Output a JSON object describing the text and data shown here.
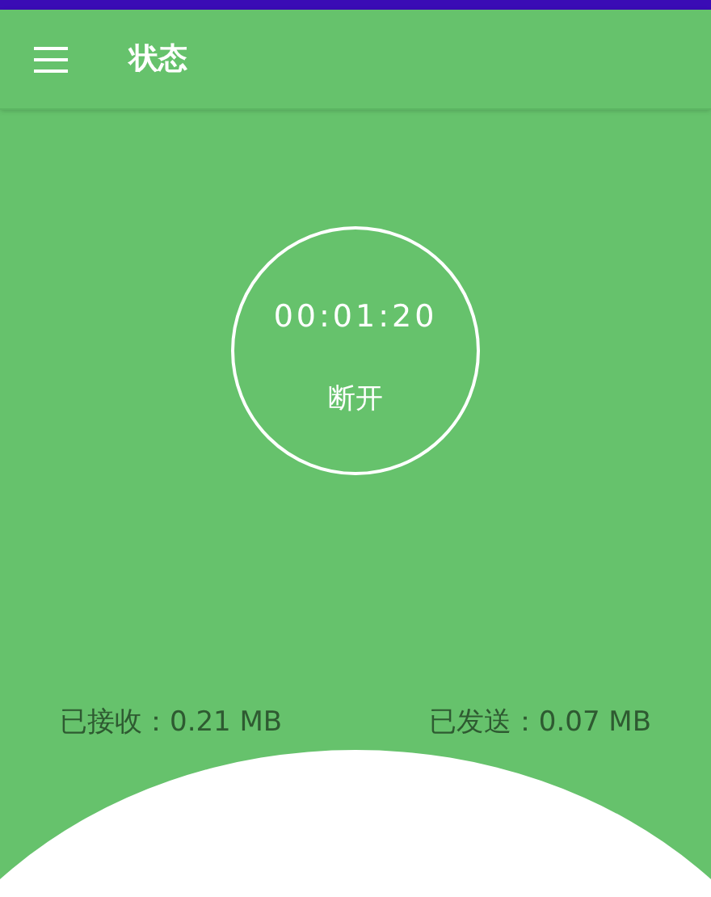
{
  "app_bar": {
    "title": "状态"
  },
  "session": {
    "timer": "00:01:20",
    "action": "断开"
  },
  "stats": [
    {
      "label": "已接收：0.21 MB"
    },
    {
      "label": "已发送：0.07 MB"
    }
  ]
}
